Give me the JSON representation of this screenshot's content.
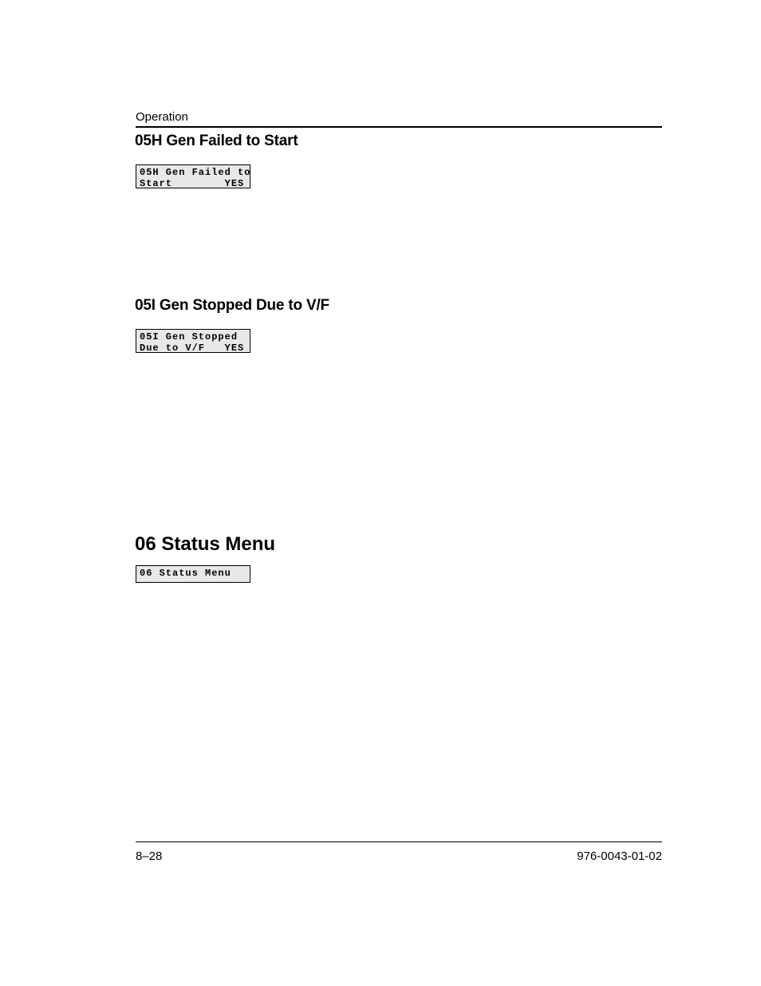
{
  "header": {
    "section": "Operation"
  },
  "sections": {
    "h05h": "05H Gen Failed to Start",
    "h05i": "05I Gen Stopped Due to V/F",
    "h06": "06 Status Menu"
  },
  "lcd": {
    "a_line1": "05H Gen Failed to",
    "a_line2": "Start        YES",
    "b_line1": "05I Gen Stopped",
    "b_line2": "Due to V/F   YES",
    "c_line1": "06 Status Menu"
  },
  "footer": {
    "page": "8–28",
    "doc": "976-0043-01-02"
  }
}
